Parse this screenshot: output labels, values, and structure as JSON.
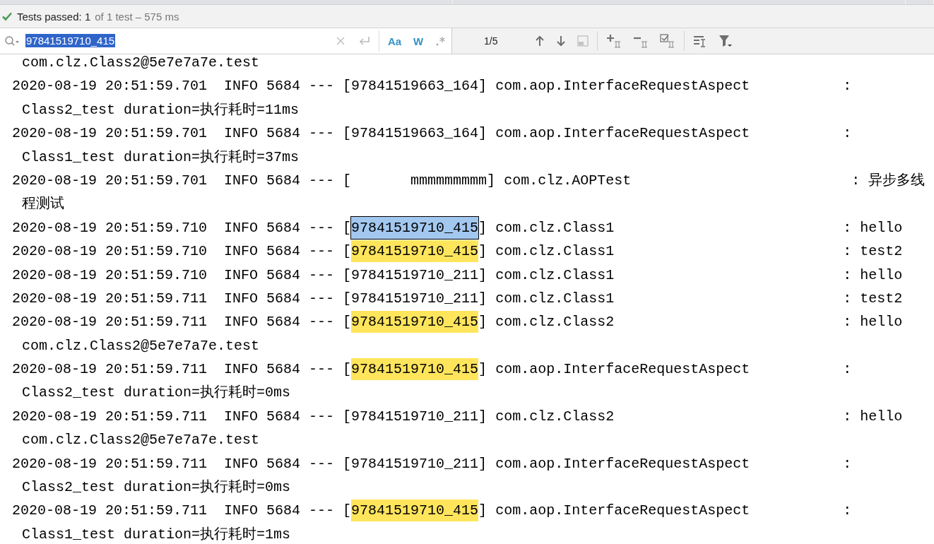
{
  "status": {
    "passed": "Tests passed: 1",
    "detail": "of 1 test – 575 ms"
  },
  "search": {
    "value": "97841519710_415",
    "match_case_label": "Aa",
    "match_case": true,
    "words_label": "W",
    "words": true,
    "regex": false,
    "count": "1/5"
  },
  "log": [
    {
      "cut_line": "com.clz.Class2@5e7e7a7e.test"
    },
    {
      "prefix": "2020-08-19 20:51:59.701  INFO 5684 --- [",
      "thread": "97841519663_164",
      "suffix": "]",
      "logger": "com.aop.InterfaceRequestAspect",
      "message": ":",
      "selected": false,
      "highlighted": false,
      "continuation": "Class2_test duration=执行耗时=11ms"
    },
    {
      "prefix": "2020-08-19 20:51:59.701  INFO 5684 --- [",
      "thread": "97841519663_164",
      "suffix": "]",
      "logger": "com.aop.InterfaceRequestAspect",
      "message": ":",
      "selected": false,
      "highlighted": false,
      "continuation": "Class1_test duration=执行耗时=37ms"
    },
    {
      "prefix": "2020-08-19 20:51:59.701  INFO 5684 --- [",
      "thread": "       mmmmmmmmm",
      "suffix": "]",
      "logger": "com.clz.AOPTest",
      "message": ": 异步多线",
      "selected": false,
      "highlighted": false,
      "continuation": "程测试"
    },
    {
      "prefix": "2020-08-19 20:51:59.710  INFO 5684 --- [",
      "thread": "97841519710_415",
      "suffix": "]",
      "logger": "com.clz.Class1",
      "message": ": hello",
      "selected": true,
      "highlighted": true
    },
    {
      "prefix": "2020-08-19 20:51:59.710  INFO 5684 --- [",
      "thread": "97841519710_415",
      "suffix": "]",
      "logger": "com.clz.Class1",
      "message": ": test2",
      "selected": false,
      "highlighted": true
    },
    {
      "prefix": "2020-08-19 20:51:59.710  INFO 5684 --- [",
      "thread": "97841519710_211",
      "suffix": "]",
      "logger": "com.clz.Class1",
      "message": ": hello",
      "selected": false,
      "highlighted": false
    },
    {
      "prefix": "2020-08-19 20:51:59.711  INFO 5684 --- [",
      "thread": "97841519710_211",
      "suffix": "]",
      "logger": "com.clz.Class1",
      "message": ": test2",
      "selected": false,
      "highlighted": false
    },
    {
      "prefix": "2020-08-19 20:51:59.711  INFO 5684 --- [",
      "thread": "97841519710_415",
      "suffix": "]",
      "logger": "com.clz.Class2",
      "message": ": hello",
      "selected": false,
      "highlighted": true,
      "continuation": "com.clz.Class2@5e7e7a7e.test"
    },
    {
      "prefix": "2020-08-19 20:51:59.711  INFO 5684 --- [",
      "thread": "97841519710_415",
      "suffix": "]",
      "logger": "com.aop.InterfaceRequestAspect",
      "message": ":",
      "selected": false,
      "highlighted": true,
      "continuation": "Class2_test duration=执行耗时=0ms"
    },
    {
      "prefix": "2020-08-19 20:51:59.711  INFO 5684 --- [",
      "thread": "97841519710_211",
      "suffix": "]",
      "logger": "com.clz.Class2",
      "message": ": hello",
      "selected": false,
      "highlighted": false,
      "continuation": "com.clz.Class2@5e7e7a7e.test"
    },
    {
      "prefix": "2020-08-19 20:51:59.711  INFO 5684 --- [",
      "thread": "97841519710_211",
      "suffix": "]",
      "logger": "com.aop.InterfaceRequestAspect",
      "message": ":",
      "selected": false,
      "highlighted": false,
      "continuation": "Class2_test duration=执行耗时=0ms"
    },
    {
      "prefix": "2020-08-19 20:51:59.711  INFO 5684 --- [",
      "thread": "97841519710_415",
      "suffix": "]",
      "logger": "com.aop.InterfaceRequestAspect",
      "message": ":",
      "selected": false,
      "highlighted": true,
      "continuation": "Class1_test duration=执行耗时=1ms"
    }
  ]
}
